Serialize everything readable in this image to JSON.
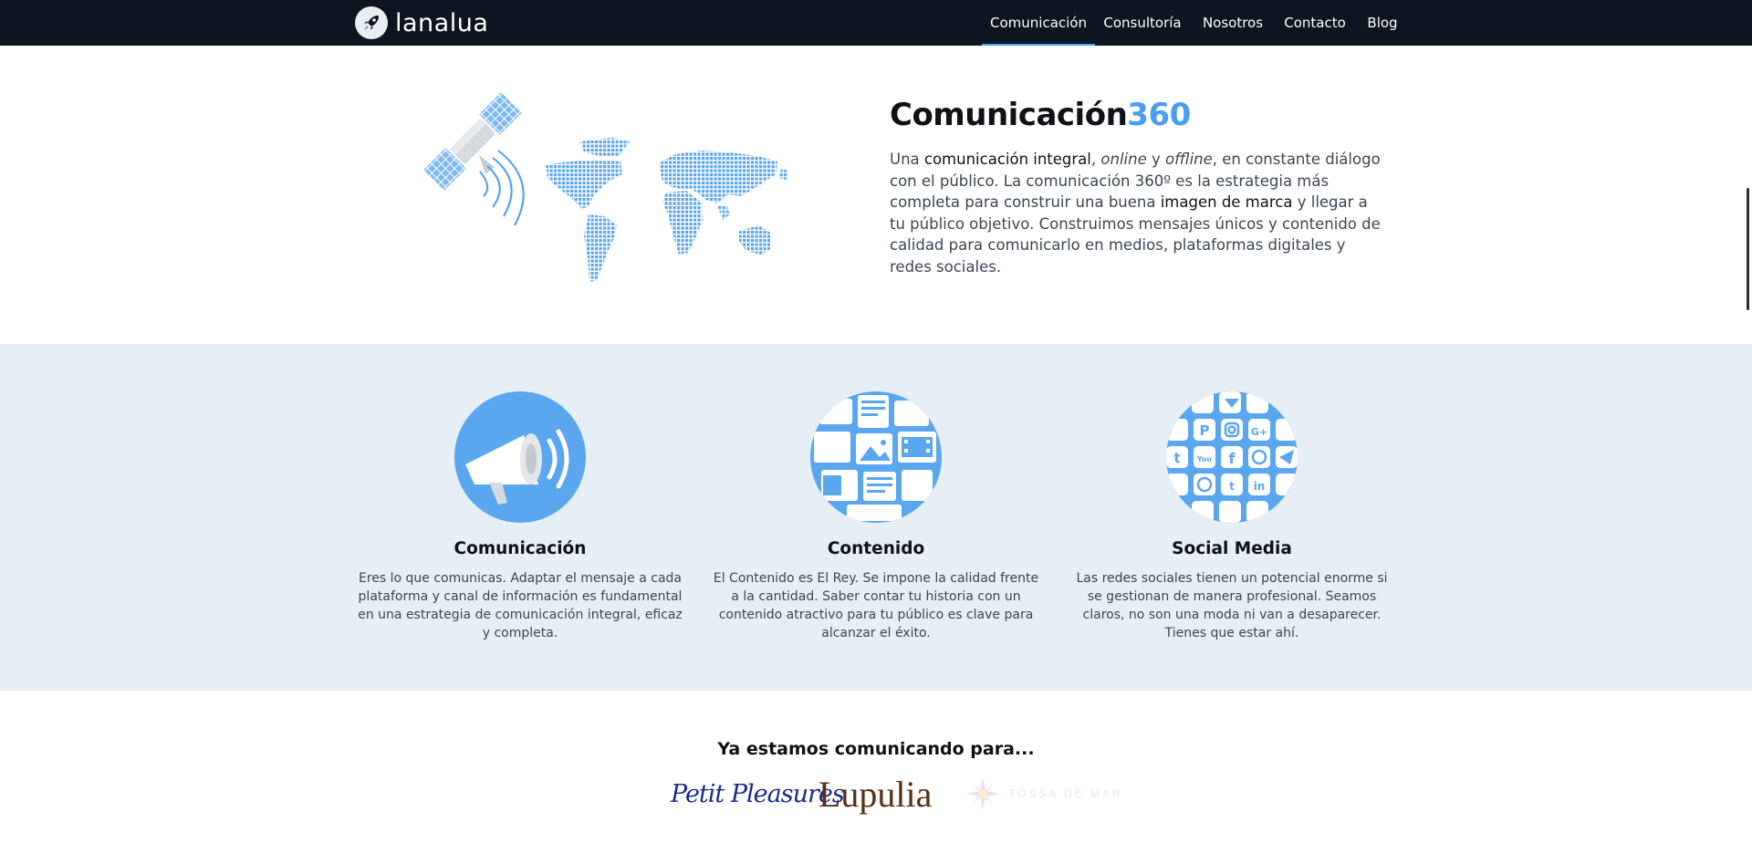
{
  "nav": {
    "brand": "lanalua",
    "items": [
      {
        "label": "Comunicación",
        "active": true
      },
      {
        "label": "Consultoría",
        "active": false
      },
      {
        "label": "Nosotros",
        "active": false
      },
      {
        "label": "Contacto",
        "active": false
      },
      {
        "label": "Blog",
        "active": false
      }
    ]
  },
  "hero": {
    "title_main": "Comunicación",
    "title_accent": "360",
    "p_t1": "Una ",
    "p_b1": "comunicación integral",
    "p_t2": ", ",
    "p_i1": "online",
    "p_t3": " y ",
    "p_i2": "offline",
    "p_t4": ", en constante diálogo con el público. La comunicación 360º es la estrategia más completa para construir una buena ",
    "p_b2": "imagen de marca",
    "p_t5": " y llegar a tu público objetivo. Construimos mensajes únicos y contenido de calidad para comunicarlo en medios, plataformas digitales y redes sociales."
  },
  "services": [
    {
      "title": "Comunicación",
      "icon": "megaphone-icon",
      "text": "Eres lo que comunicas. Adaptar el mensaje a cada plataforma y canal de información es fundamental en una estrategia de comunicación integral, eficaz y completa."
    },
    {
      "title": "Contenido",
      "icon": "content-collage-icon",
      "text": "El Contenido es El Rey. Se impone la calidad frente a la cantidad. Saber contar tu historia con un contenido atractivo para tu público es clave para alcanzar el éxito."
    },
    {
      "title": "Social Media",
      "icon": "social-networks-icon",
      "text": "Las redes sociales tienen un potencial enorme si se gestionan de manera profesional. Seamos claros, no son una moda ni van a desaparecer. Tienes que estar ahí."
    }
  ],
  "clients": {
    "title": "Ya estamos comunicando para...",
    "logos": [
      {
        "name": "Petit Pleasures"
      },
      {
        "name": "Lupulia"
      },
      {
        "name": "TOSSA DE MAR"
      }
    ]
  },
  "colors": {
    "nav_bg": "#0d1520",
    "accent": "#4a9ef0",
    "services_bg": "#e6eef6",
    "icon_circle": "#5aa6ef"
  }
}
